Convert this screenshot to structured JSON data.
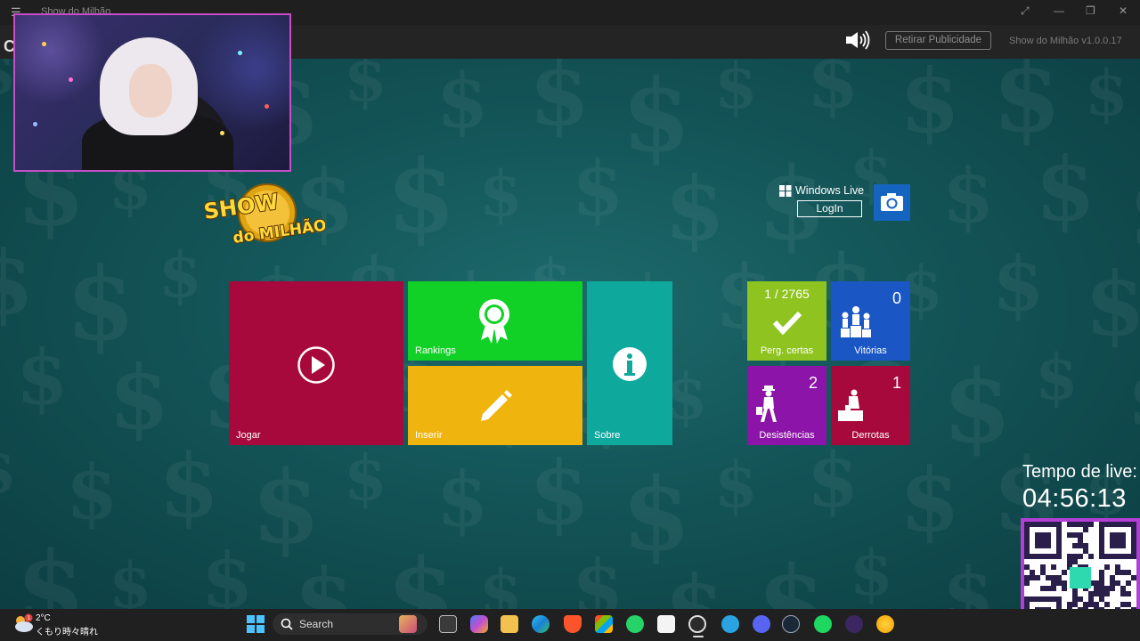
{
  "window": {
    "title": "Show do Milhão",
    "menu_icon": "hamburger-icon",
    "controls": [
      "expand-icon",
      "minimize-icon",
      "maximize-icon",
      "close-icon"
    ]
  },
  "appbar": {
    "app_initial": "C",
    "speaker_icon": "speaker-icon",
    "remove_ads_label": "Retirar Publicidade",
    "version": "Show do Milhão v1.0.0.17"
  },
  "logo": {
    "line1": "SHOW",
    "line2": "do MILHÃO"
  },
  "windows_live": {
    "label": "Windows Live",
    "login_label": "LogIn",
    "camera_icon": "camera-icon"
  },
  "tiles": {
    "jogar": {
      "label": "Jogar",
      "icon": "play-icon",
      "color": "#a8093d"
    },
    "rankings": {
      "label": "Rankings",
      "icon": "award-icon",
      "color": "#11d127"
    },
    "inserir": {
      "label": "Inserir",
      "icon": "pencil-icon",
      "color": "#f0b40f"
    },
    "sobre": {
      "label": "Sobre",
      "icon": "info-icon",
      "color": "#0ea89d"
    }
  },
  "stats": {
    "correct": {
      "count": "1 / 2765",
      "label": "Perg. certas",
      "icon": "check-icon",
      "color": "#8fc31f"
    },
    "wins": {
      "count": "0",
      "label": "Vitórias",
      "icon": "podium-icon",
      "color": "#1a56c4"
    },
    "quits": {
      "count": "2",
      "label": "Desistências",
      "icon": "walking-man-icon",
      "color": "#8c14a8"
    },
    "losses": {
      "count": "1",
      "label": "Derrotas",
      "icon": "sitting-man-icon",
      "color": "#a8093d"
    }
  },
  "live": {
    "label": "Tempo de live:",
    "time": "04:56:13"
  },
  "taskbar": {
    "weather_temp": "2°C",
    "weather_desc": "くもり時々晴れ",
    "weather_badge": "1",
    "search_label": "Search",
    "apps": [
      "windows-start-icon",
      "search-icon",
      "task-view-icon",
      "copilot-icon",
      "file-explorer-icon",
      "edge-icon",
      "brave-icon",
      "store-icon",
      "whatsapp-icon",
      "app-icon",
      "obs-icon",
      "telegram-icon",
      "discord-icon",
      "steam-icon",
      "spotify-icon",
      "app-icon-2",
      "game-icon"
    ]
  }
}
